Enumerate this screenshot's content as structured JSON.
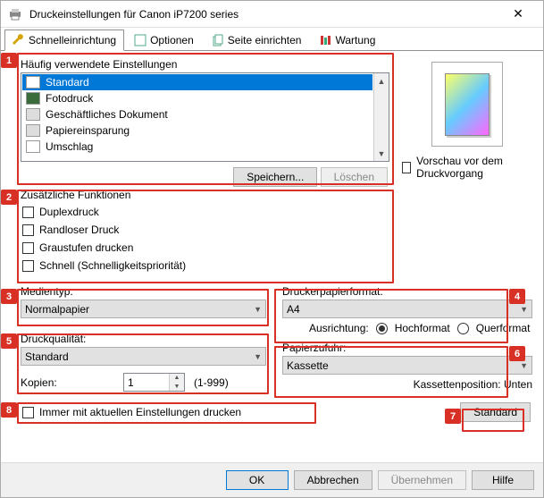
{
  "window": {
    "title": "Druckeinstellungen für Canon iP7200 series"
  },
  "tabs": {
    "quick": "Schnelleinrichtung",
    "options": "Optionen",
    "page": "Seite einrichten",
    "maint": "Wartung"
  },
  "freq": {
    "label": "Häufig verwendete Einstellungen",
    "items": [
      "Standard",
      "Fotodruck",
      "Geschäftliches Dokument",
      "Papiereinsparung",
      "Umschlag"
    ],
    "save": "Speichern...",
    "delete": "Löschen"
  },
  "preview_check": "Vorschau vor dem Druckvorgang",
  "extra": {
    "label": "Zusätzliche Funktionen",
    "items": [
      "Duplexdruck",
      "Randloser Druck",
      "Graustufen drucken",
      "Schnell (Schnelligkeitspriorität)"
    ]
  },
  "media": {
    "label": "Medientyp:",
    "value": "Normalpapier"
  },
  "quality": {
    "label": "Druckqualität:",
    "value": "Standard"
  },
  "copies": {
    "label": "Kopien:",
    "value": "1",
    "range": "(1-999)"
  },
  "paperfmt": {
    "label": "Druckerpapierformat:",
    "value": "A4"
  },
  "orient": {
    "label": "Ausrichtung:",
    "portrait": "Hochformat",
    "landscape": "Querformat"
  },
  "source": {
    "label": "Papierzufuhr:",
    "value": "Kassette",
    "pos": "Kassettenposition: Unten"
  },
  "always": "Immer mit aktuellen Einstellungen drucken",
  "defaults": "Standard",
  "footer": {
    "ok": "OK",
    "cancel": "Abbrechen",
    "apply": "Übernehmen",
    "help": "Hilfe"
  },
  "annotations": [
    "1",
    "2",
    "3",
    "4",
    "5",
    "6",
    "7",
    "8"
  ]
}
